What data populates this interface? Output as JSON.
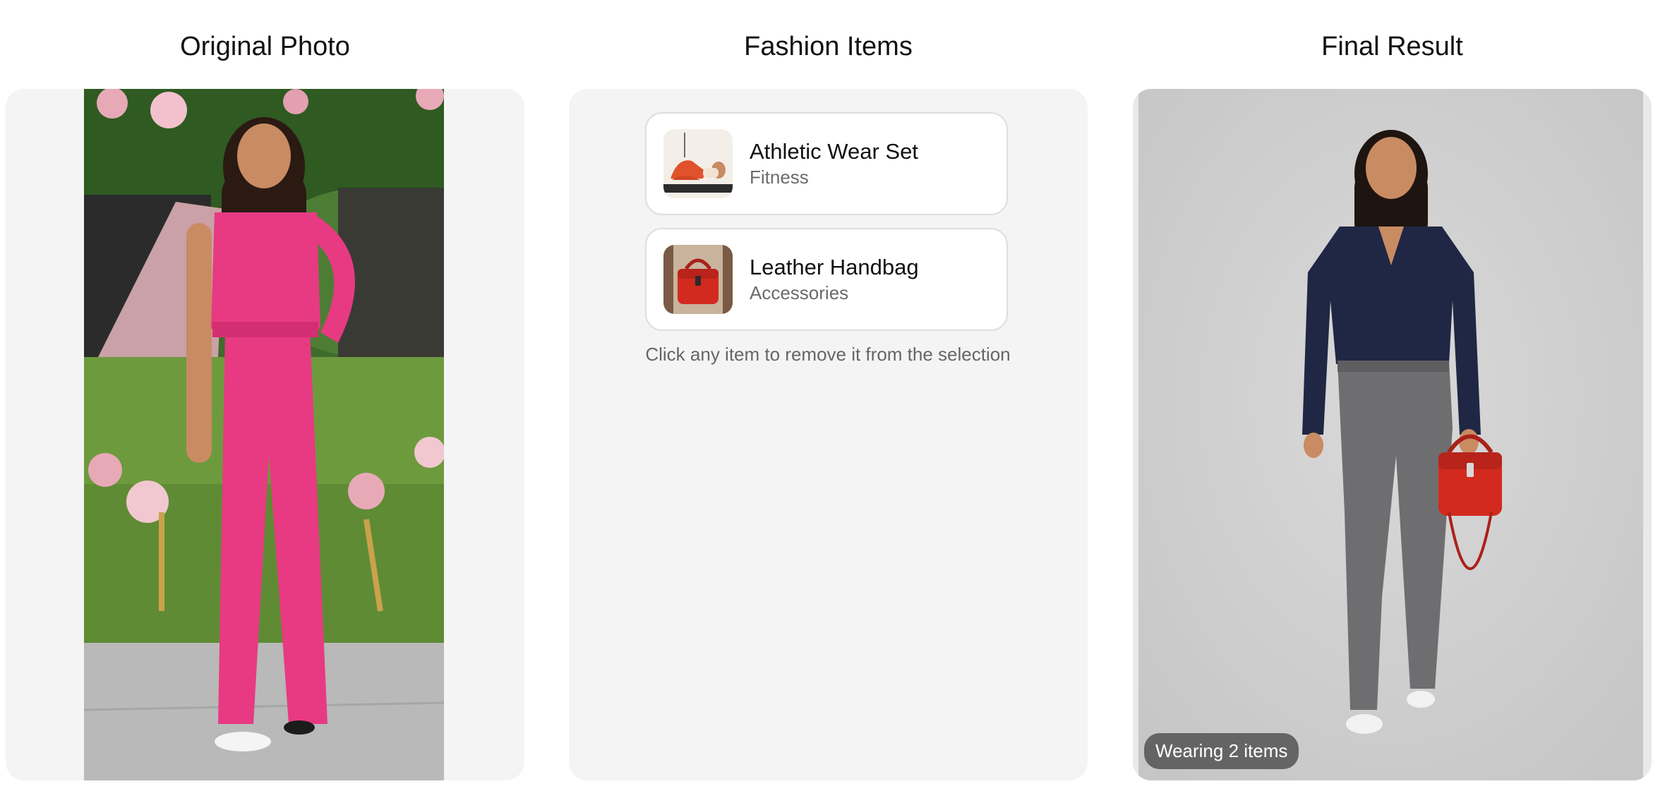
{
  "columns": {
    "original": {
      "title": "Original Photo"
    },
    "items": {
      "title": "Fashion Items"
    },
    "result": {
      "title": "Final Result"
    }
  },
  "fashion_items": [
    {
      "name": "Athletic Wear Set",
      "category": "Fitness"
    },
    {
      "name": "Leather Handbag",
      "category": "Accessories"
    }
  ],
  "hint": "Click any item to remove it from the selection",
  "result_badge": "Wearing 2 items",
  "colors": {
    "panel_bg": "#f4f4f4",
    "jumpsuit_pink": "#e73a82",
    "handbag_red": "#d32a1f",
    "blouse_navy": "#1f2744",
    "trousers_gray": "#6e6e70"
  }
}
